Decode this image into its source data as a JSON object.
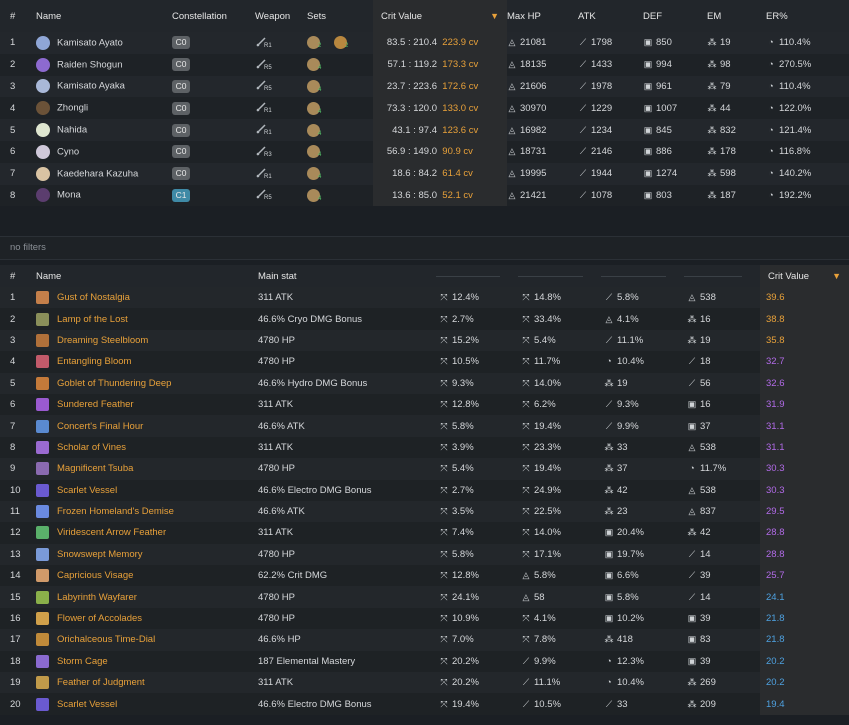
{
  "characters": {
    "headers": {
      "num": "#",
      "name": "Name",
      "constellation": "Constellation",
      "weapon": "Weapon",
      "sets": "Sets",
      "cv": "Crit Value",
      "hp": "Max HP",
      "atk": "ATK",
      "def": "DEF",
      "em": "EM",
      "er": "ER%"
    },
    "rows": [
      {
        "num": "1",
        "name": "Kamisato Ayato",
        "cons": "C0",
        "wr": "R1",
        "sets": [
          "2",
          "2"
        ],
        "cv": "83.5 : 210.4",
        "cv2": "223.9 cv",
        "hp": "21081",
        "atk": "1798",
        "def": "850",
        "em": "19",
        "er": "110.4%",
        "color": "#8fa6d6"
      },
      {
        "num": "2",
        "name": "Raiden Shogun",
        "cons": "C0",
        "wr": "R5",
        "sets": [
          "4"
        ],
        "cv": "57.1 : 119.2",
        "cv2": "173.3 cv",
        "hp": "18135",
        "atk": "1433",
        "def": "994",
        "em": "98",
        "er": "270.5%",
        "color": "#8d6ad0"
      },
      {
        "num": "3",
        "name": "Kamisato Ayaka",
        "cons": "C0",
        "wr": "R5",
        "sets": [
          "4"
        ],
        "cv": "23.7 : 223.6",
        "cv2": "172.6 cv",
        "hp": "21606",
        "atk": "1978",
        "def": "961",
        "em": "79",
        "er": "110.4%",
        "color": "#a9b8d8"
      },
      {
        "num": "4",
        "name": "Zhongli",
        "cons": "C0",
        "wr": "R1",
        "sets": [
          "4"
        ],
        "cv": "73.3 : 120.0",
        "cv2": "133.0 cv",
        "hp": "30970",
        "atk": "1229",
        "def": "1007",
        "em": "44",
        "er": "122.0%",
        "color": "#6b5238"
      },
      {
        "num": "5",
        "name": "Nahida",
        "cons": "C0",
        "wr": "R1",
        "sets": [
          "4"
        ],
        "cv": "43.1 : 97.4",
        "cv2": "123.6 cv",
        "hp": "16982",
        "atk": "1234",
        "def": "845",
        "em": "832",
        "er": "121.4%",
        "color": "#dfe6d0"
      },
      {
        "num": "6",
        "name": "Cyno",
        "cons": "C0",
        "wr": "R3",
        "sets": [
          "4"
        ],
        "cv": "56.9 : 149.0",
        "cv2": "90.9 cv",
        "hp": "18731",
        "atk": "2146",
        "def": "886",
        "em": "178",
        "er": "116.8%",
        "color": "#cfc8d9"
      },
      {
        "num": "7",
        "name": "Kaedehara Kazuha",
        "cons": "C0",
        "wr": "R1",
        "sets": [
          "4"
        ],
        "cv": "18.6 : 84.2",
        "cv2": "61.4 cv",
        "hp": "19995",
        "atk": "1944",
        "def": "1274",
        "em": "598",
        "er": "140.2%",
        "color": "#d9c3a3"
      },
      {
        "num": "8",
        "name": "Mona",
        "cons": "C1",
        "wr": "R5",
        "sets": [
          "4"
        ],
        "cv": "13.6 : 85.0",
        "cv2": "52.1 cv",
        "hp": "21421",
        "atk": "1078",
        "def": "803",
        "em": "187",
        "er": "192.2%",
        "color": "#5b3d6e"
      }
    ]
  },
  "filter": {
    "placeholder": "no filters"
  },
  "artifacts": {
    "headers": {
      "num": "#",
      "name": "Name",
      "main": "Main stat",
      "cv": "Crit Value"
    },
    "rows": [
      {
        "num": "1",
        "name": "Gust of Nostalgia",
        "main": "311 ATK",
        "s": [
          [
            "crit",
            "12.4%"
          ],
          [
            "crit",
            "14.8%"
          ],
          [
            "atk",
            "5.8%"
          ],
          [
            "hp",
            "538"
          ]
        ],
        "cv": "39.6",
        "cvc": "o",
        "ic": "#c47f4a"
      },
      {
        "num": "2",
        "name": "Lamp of the Lost",
        "main": "46.6% Cryo DMG Bonus",
        "s": [
          [
            "crit",
            "2.7%"
          ],
          [
            "crit",
            "33.4%"
          ],
          [
            "hp",
            "4.1%"
          ],
          [
            "em",
            "16"
          ]
        ],
        "cv": "38.8",
        "cvc": "o",
        "ic": "#8a8f5a"
      },
      {
        "num": "3",
        "name": "Dreaming Steelbloom",
        "main": "4780 HP",
        "s": [
          [
            "crit",
            "15.2%"
          ],
          [
            "crit",
            "5.4%"
          ],
          [
            "atk",
            "11.1%"
          ],
          [
            "em",
            "19"
          ]
        ],
        "cv": "35.8",
        "cvc": "o",
        "ic": "#b0703a"
      },
      {
        "num": "4",
        "name": "Entangling Bloom",
        "main": "4780 HP",
        "s": [
          [
            "crit",
            "10.5%"
          ],
          [
            "crit",
            "11.7%"
          ],
          [
            "er",
            "10.4%"
          ],
          [
            "atk",
            "18"
          ]
        ],
        "cv": "32.7",
        "cvc": "p",
        "ic": "#c25a6a"
      },
      {
        "num": "5",
        "name": "Goblet of Thundering Deep",
        "main": "46.6% Hydro DMG Bonus",
        "s": [
          [
            "crit",
            "9.3%"
          ],
          [
            "crit",
            "14.0%"
          ],
          [
            "em",
            "19"
          ],
          [
            "atk",
            "56"
          ]
        ],
        "cv": "32.6",
        "cvc": "p",
        "ic": "#c47a3a"
      },
      {
        "num": "6",
        "name": "Sundered Feather",
        "main": "311 ATK",
        "s": [
          [
            "crit",
            "12.8%"
          ],
          [
            "crit",
            "6.2%"
          ],
          [
            "atk",
            "9.3%"
          ],
          [
            "def",
            "16"
          ]
        ],
        "cv": "31.9",
        "cvc": "p",
        "ic": "#9a5ad0"
      },
      {
        "num": "7",
        "name": "Concert's Final Hour",
        "main": "46.6% ATK",
        "s": [
          [
            "crit",
            "5.8%"
          ],
          [
            "crit",
            "19.4%"
          ],
          [
            "atk",
            "9.9%"
          ],
          [
            "def",
            "37"
          ]
        ],
        "cv": "31.1",
        "cvc": "p",
        "ic": "#5a8ad0"
      },
      {
        "num": "8",
        "name": "Scholar of Vines",
        "main": "311 ATK",
        "s": [
          [
            "crit",
            "3.9%"
          ],
          [
            "crit",
            "23.3%"
          ],
          [
            "em",
            "33"
          ],
          [
            "hp",
            "538"
          ]
        ],
        "cv": "31.1",
        "cvc": "p",
        "ic": "#9a6ad0"
      },
      {
        "num": "9",
        "name": "Magnificent Tsuba",
        "main": "4780 HP",
        "s": [
          [
            "crit",
            "5.4%"
          ],
          [
            "crit",
            "19.4%"
          ],
          [
            "em",
            "37"
          ],
          [
            "er",
            "11.7%"
          ]
        ],
        "cv": "30.3",
        "cvc": "p",
        "ic": "#8a6ab0"
      },
      {
        "num": "10",
        "name": "Scarlet Vessel",
        "main": "46.6% Electro DMG Bonus",
        "s": [
          [
            "crit",
            "2.7%"
          ],
          [
            "crit",
            "24.9%"
          ],
          [
            "em",
            "42"
          ],
          [
            "hp",
            "538"
          ]
        ],
        "cv": "30.3",
        "cvc": "p",
        "ic": "#6a5ad0"
      },
      {
        "num": "11",
        "name": "Frozen Homeland's Demise",
        "main": "46.6% ATK",
        "s": [
          [
            "crit",
            "3.5%"
          ],
          [
            "crit",
            "22.5%"
          ],
          [
            "em",
            "23"
          ],
          [
            "hp",
            "837"
          ]
        ],
        "cv": "29.5",
        "cvc": "p",
        "ic": "#6a8ae0"
      },
      {
        "num": "12",
        "name": "Viridescent Arrow Feather",
        "main": "311 ATK",
        "s": [
          [
            "crit",
            "7.4%"
          ],
          [
            "crit",
            "14.0%"
          ],
          [
            "def",
            "20.4%"
          ],
          [
            "em",
            "42"
          ]
        ],
        "cv": "28.8",
        "cvc": "p",
        "ic": "#5ab06a"
      },
      {
        "num": "13",
        "name": "Snowswept Memory",
        "main": "4780 HP",
        "s": [
          [
            "crit",
            "5.8%"
          ],
          [
            "crit",
            "17.1%"
          ],
          [
            "def",
            "19.7%"
          ],
          [
            "atk",
            "14"
          ]
        ],
        "cv": "28.8",
        "cvc": "p",
        "ic": "#7a9ad8"
      },
      {
        "num": "14",
        "name": "Capricious Visage",
        "main": "62.2% Crit DMG",
        "s": [
          [
            "crit",
            "12.8%"
          ],
          [
            "hp",
            "5.8%"
          ],
          [
            "def",
            "6.6%"
          ],
          [
            "atk",
            "39"
          ]
        ],
        "cv": "25.7",
        "cvc": "p",
        "ic": "#d09a6a"
      },
      {
        "num": "15",
        "name": "Labyrinth Wayfarer",
        "main": "4780 HP",
        "s": [
          [
            "crit",
            "24.1%"
          ],
          [
            "hp",
            "58"
          ],
          [
            "def",
            "5.8%"
          ],
          [
            "atk",
            "14"
          ]
        ],
        "cv": "24.1",
        "cvc": "b",
        "ic": "#8ab04a"
      },
      {
        "num": "16",
        "name": "Flower of Accolades",
        "main": "4780 HP",
        "s": [
          [
            "crit",
            "10.9%"
          ],
          [
            "crit",
            "4.1%"
          ],
          [
            "def",
            "10.2%"
          ],
          [
            "def",
            "39"
          ]
        ],
        "cv": "21.8",
        "cvc": "b",
        "ic": "#d0a04a"
      },
      {
        "num": "17",
        "name": "Orichalceous Time-Dial",
        "main": "46.6% HP",
        "s": [
          [
            "crit",
            "7.0%"
          ],
          [
            "crit",
            "7.8%"
          ],
          [
            "em",
            "418"
          ],
          [
            "def",
            "83"
          ]
        ],
        "cv": "21.8",
        "cvc": "b",
        "ic": "#c08a3a"
      },
      {
        "num": "18",
        "name": "Storm Cage",
        "main": "187 Elemental Mastery",
        "s": [
          [
            "crit",
            "20.2%"
          ],
          [
            "atk",
            "9.9%"
          ],
          [
            "er",
            "12.3%"
          ],
          [
            "def",
            "39"
          ]
        ],
        "cv": "20.2",
        "cvc": "b",
        "ic": "#8a6ad0"
      },
      {
        "num": "19",
        "name": "Feather of Judgment",
        "main": "311 ATK",
        "s": [
          [
            "crit",
            "20.2%"
          ],
          [
            "atk",
            "11.1%"
          ],
          [
            "er",
            "10.4%"
          ],
          [
            "em",
            "269"
          ]
        ],
        "cv": "20.2",
        "cvc": "b",
        "ic": "#c09a4a"
      },
      {
        "num": "20",
        "name": "Scarlet Vessel",
        "main": "46.6% Electro DMG Bonus",
        "s": [
          [
            "crit",
            "19.4%"
          ],
          [
            "atk",
            "10.5%"
          ],
          [
            "atk",
            "33"
          ],
          [
            "em",
            "209"
          ]
        ],
        "cv": "19.4",
        "cvc": "b",
        "ic": "#6a5ad0"
      }
    ]
  }
}
